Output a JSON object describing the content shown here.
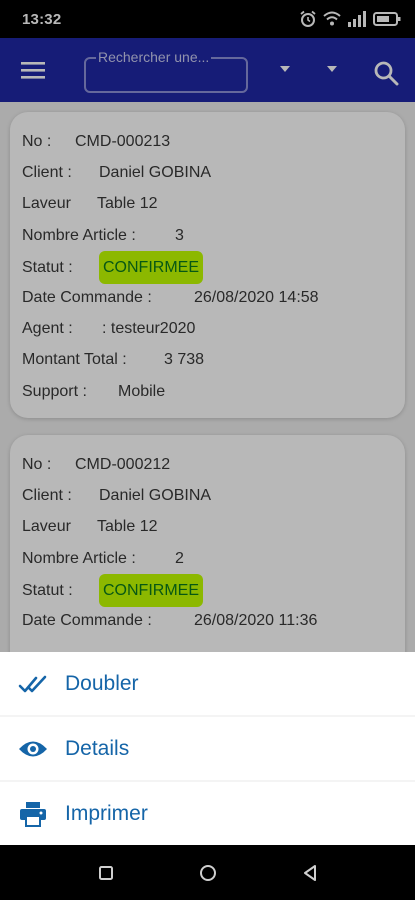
{
  "status_bar": {
    "time": "13:32"
  },
  "app_bar": {
    "search_placeholder": "Rechercher une...",
    "icons": [
      "menu-icon",
      "chevron-down-icon",
      "chevron-down-icon",
      "search-icon"
    ]
  },
  "orders": [
    {
      "no_label": "No :",
      "no": "CMD-000213",
      "client_label": "Client :",
      "client": "Daniel GOBINA",
      "laveur_label": "Laveur",
      "laveur": "Table 12",
      "articles_label": "Nombre Article :",
      "articles": "3",
      "statut_label": "Statut :",
      "statut": "CONFIRMEE",
      "date_label": "Date Commande :",
      "date": "26/08/2020 14:58",
      "agent_label": "Agent :",
      "agent": ": testeur2020",
      "montant_label": "Montant Total :",
      "montant": "3 738",
      "support_label": "Support :",
      "support": "Mobile"
    },
    {
      "no_label": "No :",
      "no": "CMD-000212",
      "client_label": "Client :",
      "client": "Daniel GOBINA",
      "laveur_label": "Laveur",
      "laveur": "Table 12",
      "articles_label": "Nombre Article :",
      "articles": "2",
      "statut_label": "Statut :",
      "statut": "CONFIRMEE",
      "date_label": "Date Commande :",
      "date": "26/08/2020 11:36"
    }
  ],
  "action_sheet": {
    "items": [
      {
        "label": "Doubler",
        "icon": "double-check-icon"
      },
      {
        "label": "Details",
        "icon": "eye-icon"
      },
      {
        "label": "Imprimer",
        "icon": "printer-icon"
      }
    ]
  },
  "colors": {
    "app_bar": "#1f27a6",
    "status_badge_bg": "#c3ff00",
    "status_badge_text": "#0a7a1c",
    "sheet_text": "#1565a8"
  }
}
